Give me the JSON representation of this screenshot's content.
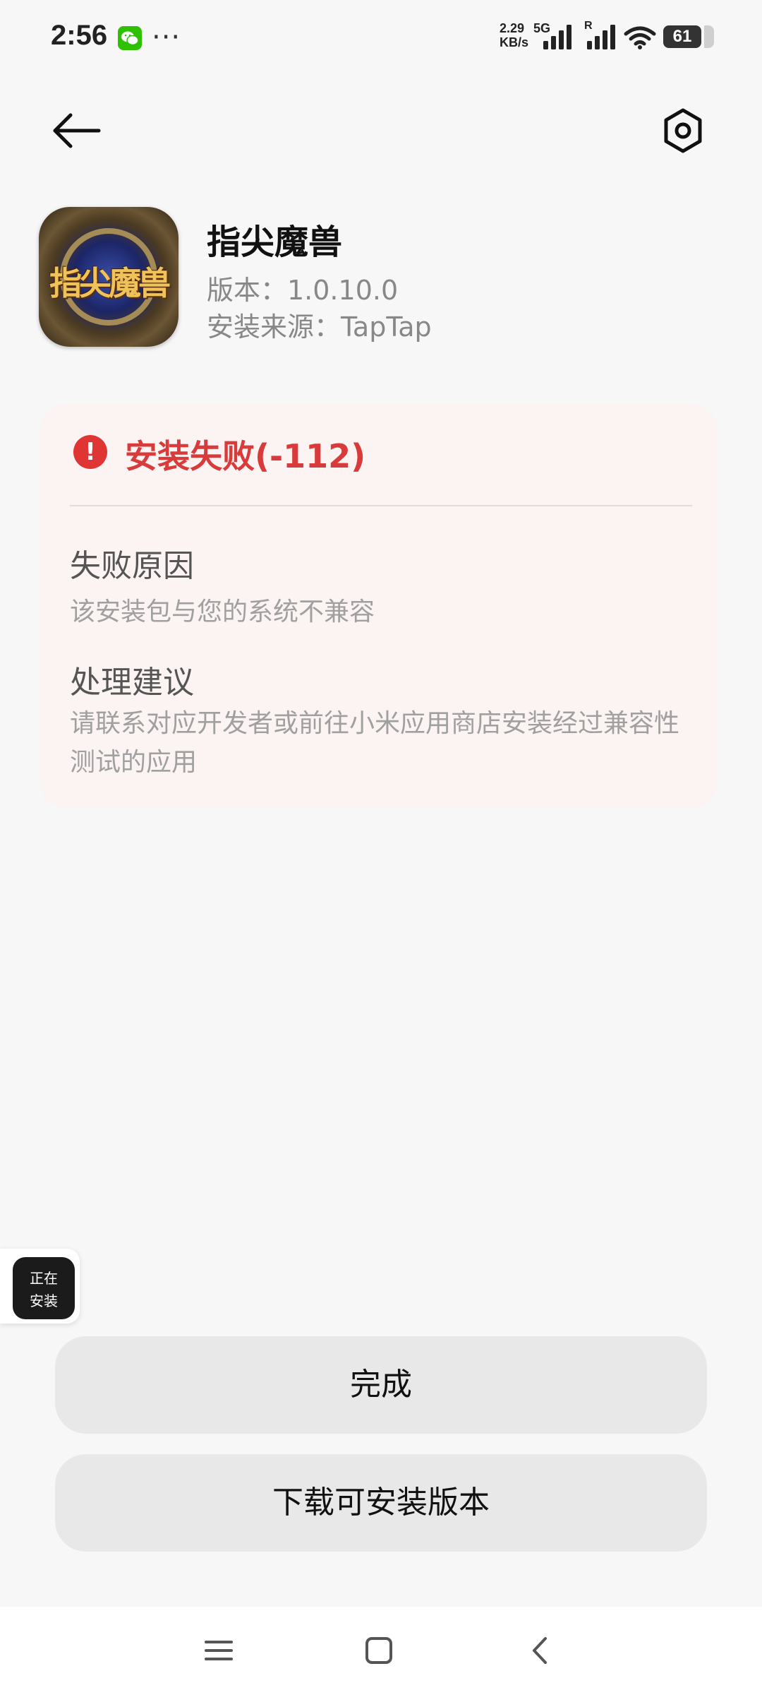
{
  "status_bar": {
    "time": "2:56",
    "notification_icons": [
      "wechat-icon",
      "more-dots-icon"
    ],
    "more_dots": "···",
    "net_speed_value": "2.29",
    "net_speed_unit": "KB/s",
    "network_type": "5G",
    "roaming_label": "R",
    "battery": "61"
  },
  "header": {
    "back_icon": "arrow-left-icon",
    "settings_icon": "hexagon-settings-icon"
  },
  "app": {
    "name": "指尖魔兽",
    "icon_text": "指尖魔兽",
    "version": "版本：1.0.10.0",
    "source": "安装来源：TapTap"
  },
  "error": {
    "title": "安装失败(-112)",
    "icon_symbol": "!",
    "reason_heading": "失败原因",
    "reason_text": "该安装包与您的系统不兼容",
    "suggestion_heading": "处理建议",
    "suggestion_text": "请联系对应开发者或前往小米应用商店安装经过兼容性测试的应用",
    "accent_color": "#d93a3a"
  },
  "installing_bubble": {
    "line1": "正在",
    "line2": "安装"
  },
  "buttons": {
    "done": "完成",
    "download": "下载可安装版本"
  },
  "nav": {
    "menu_icon": "menu-icon",
    "home_icon": "home-square-icon",
    "back_icon": "back-chevron-icon"
  }
}
